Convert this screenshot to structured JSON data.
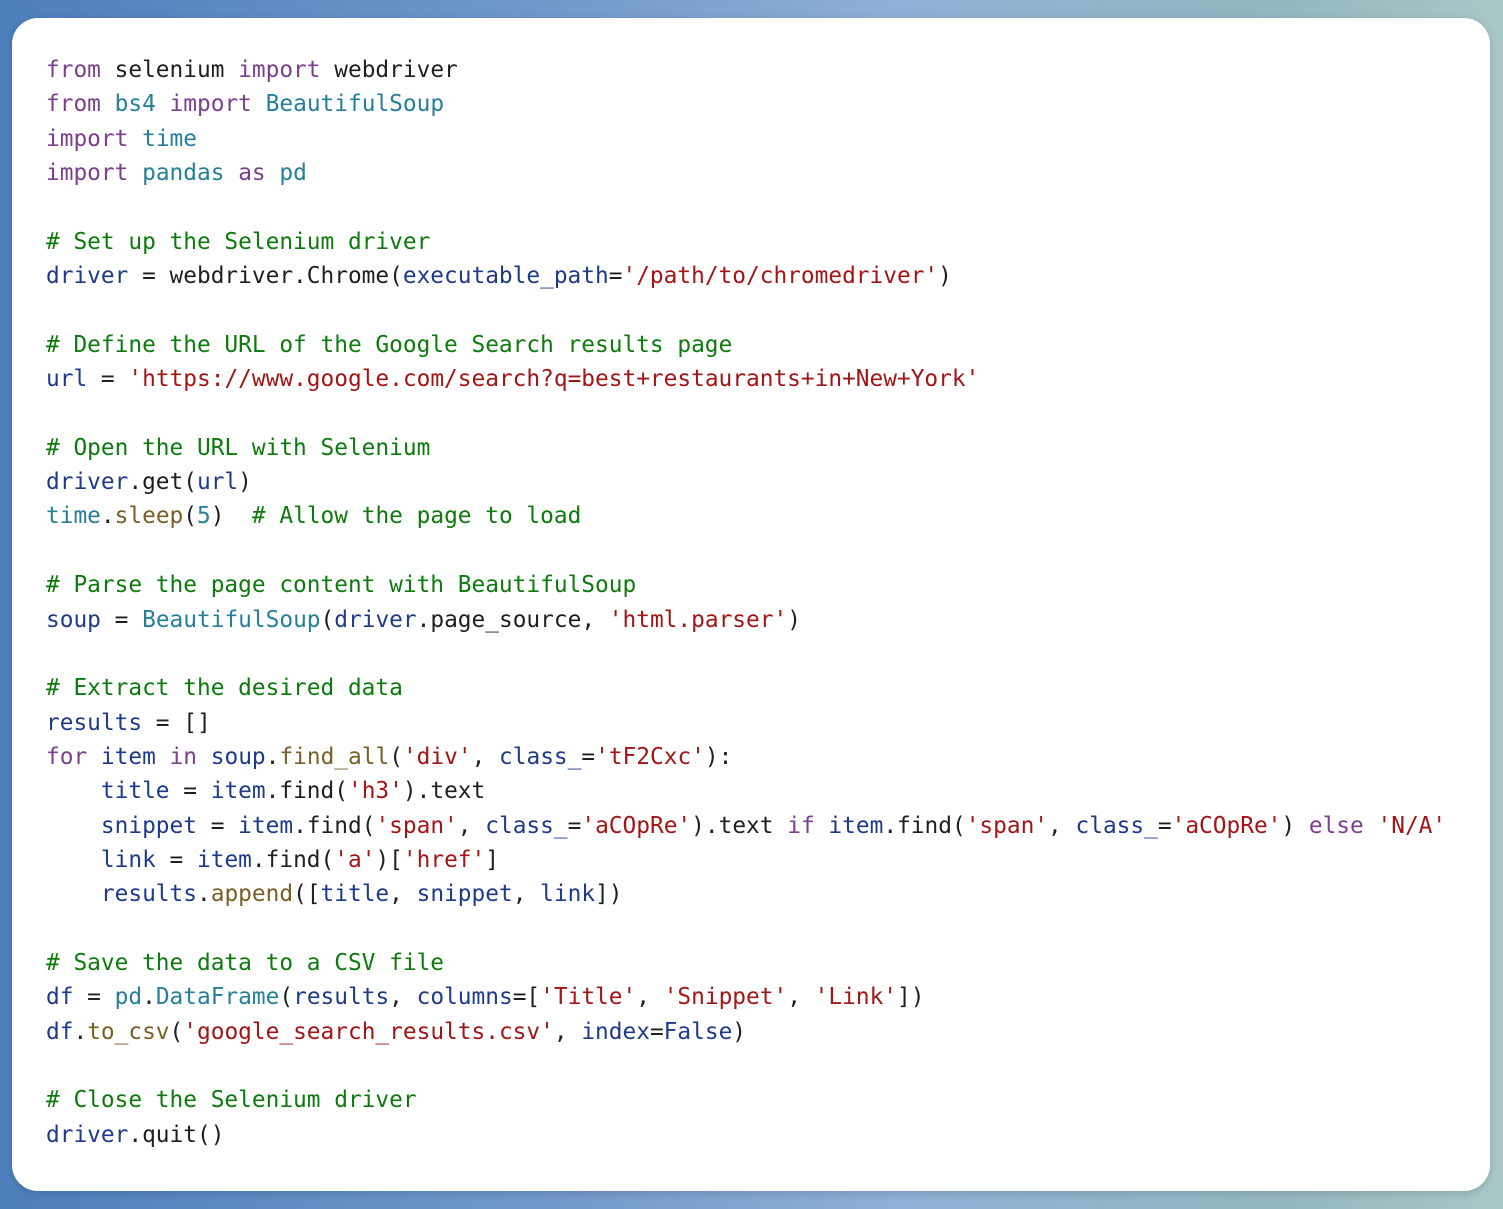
{
  "code_lines": [
    [
      {
        "t": "kw",
        "v": "from"
      },
      {
        "t": "pl",
        "v": " selenium "
      },
      {
        "t": "kw",
        "v": "import"
      },
      {
        "t": "pl",
        "v": " webdriver"
      }
    ],
    [
      {
        "t": "kw",
        "v": "from"
      },
      {
        "t": "pl",
        "v": " "
      },
      {
        "t": "mod",
        "v": "bs4"
      },
      {
        "t": "pl",
        "v": " "
      },
      {
        "t": "kw",
        "v": "import"
      },
      {
        "t": "pl",
        "v": " "
      },
      {
        "t": "mod",
        "v": "BeautifulSoup"
      }
    ],
    [
      {
        "t": "kw",
        "v": "import"
      },
      {
        "t": "pl",
        "v": " "
      },
      {
        "t": "mod",
        "v": "time"
      }
    ],
    [
      {
        "t": "kw",
        "v": "import"
      },
      {
        "t": "pl",
        "v": " "
      },
      {
        "t": "mod",
        "v": "pandas"
      },
      {
        "t": "pl",
        "v": " "
      },
      {
        "t": "kw",
        "v": "as"
      },
      {
        "t": "pl",
        "v": " "
      },
      {
        "t": "mod",
        "v": "pd"
      }
    ],
    [],
    [
      {
        "t": "cm",
        "v": "# Set up the Selenium driver"
      }
    ],
    [
      {
        "t": "prm",
        "v": "driver"
      },
      {
        "t": "pl",
        "v": " = webdriver.Chrome("
      },
      {
        "t": "prm",
        "v": "executable_path"
      },
      {
        "t": "pl",
        "v": "="
      },
      {
        "t": "st",
        "v": "'/path/to/chromedriver'"
      },
      {
        "t": "pl",
        "v": ")"
      }
    ],
    [],
    [
      {
        "t": "cm",
        "v": "# Define the URL of the Google Search results page"
      }
    ],
    [
      {
        "t": "prm",
        "v": "url"
      },
      {
        "t": "pl",
        "v": " = "
      },
      {
        "t": "st",
        "v": "'https://www.google.com/search?q=best+restaurants+in+New+York'"
      }
    ],
    [],
    [
      {
        "t": "cm",
        "v": "# Open the URL with Selenium"
      }
    ],
    [
      {
        "t": "prm",
        "v": "driver"
      },
      {
        "t": "pl",
        "v": ".get("
      },
      {
        "t": "prm",
        "v": "url"
      },
      {
        "t": "pl",
        "v": ")"
      }
    ],
    [
      {
        "t": "mod",
        "v": "time"
      },
      {
        "t": "pl",
        "v": "."
      },
      {
        "t": "fn",
        "v": "sleep"
      },
      {
        "t": "pl",
        "v": "("
      },
      {
        "t": "nm",
        "v": "5"
      },
      {
        "t": "pl",
        "v": ")  "
      },
      {
        "t": "cm",
        "v": "# Allow the page to load"
      }
    ],
    [],
    [
      {
        "t": "cm",
        "v": "# Parse the page content with BeautifulSoup"
      }
    ],
    [
      {
        "t": "prm",
        "v": "soup"
      },
      {
        "t": "pl",
        "v": " = "
      },
      {
        "t": "mod",
        "v": "BeautifulSoup"
      },
      {
        "t": "pl",
        "v": "("
      },
      {
        "t": "prm",
        "v": "driver"
      },
      {
        "t": "pl",
        "v": ".page_source, "
      },
      {
        "t": "st",
        "v": "'html.parser'"
      },
      {
        "t": "pl",
        "v": ")"
      }
    ],
    [],
    [
      {
        "t": "cm",
        "v": "# Extract the desired data"
      }
    ],
    [
      {
        "t": "prm",
        "v": "results"
      },
      {
        "t": "pl",
        "v": " = []"
      }
    ],
    [
      {
        "t": "kw",
        "v": "for"
      },
      {
        "t": "pl",
        "v": " "
      },
      {
        "t": "prm",
        "v": "item"
      },
      {
        "t": "pl",
        "v": " "
      },
      {
        "t": "kw",
        "v": "in"
      },
      {
        "t": "pl",
        "v": " "
      },
      {
        "t": "prm",
        "v": "soup"
      },
      {
        "t": "pl",
        "v": "."
      },
      {
        "t": "fn",
        "v": "find_all"
      },
      {
        "t": "pl",
        "v": "("
      },
      {
        "t": "st",
        "v": "'div'"
      },
      {
        "t": "pl",
        "v": ", "
      },
      {
        "t": "prm",
        "v": "class_"
      },
      {
        "t": "pl",
        "v": "="
      },
      {
        "t": "st",
        "v": "'tF2Cxc'"
      },
      {
        "t": "pl",
        "v": "):"
      }
    ],
    [
      {
        "t": "pl",
        "v": "    "
      },
      {
        "t": "prm",
        "v": "title"
      },
      {
        "t": "pl",
        "v": " = "
      },
      {
        "t": "prm",
        "v": "item"
      },
      {
        "t": "pl",
        "v": ".find("
      },
      {
        "t": "st",
        "v": "'h3'"
      },
      {
        "t": "pl",
        "v": ").text"
      }
    ],
    [
      {
        "t": "pl",
        "v": "    "
      },
      {
        "t": "prm",
        "v": "snippet"
      },
      {
        "t": "pl",
        "v": " = "
      },
      {
        "t": "prm",
        "v": "item"
      },
      {
        "t": "pl",
        "v": ".find("
      },
      {
        "t": "st",
        "v": "'span'"
      },
      {
        "t": "pl",
        "v": ", "
      },
      {
        "t": "prm",
        "v": "class_"
      },
      {
        "t": "pl",
        "v": "="
      },
      {
        "t": "st",
        "v": "'aCOpRe'"
      },
      {
        "t": "pl",
        "v": ").text "
      },
      {
        "t": "kw",
        "v": "if"
      },
      {
        "t": "pl",
        "v": " "
      },
      {
        "t": "prm",
        "v": "item"
      },
      {
        "t": "pl",
        "v": ".find("
      },
      {
        "t": "st",
        "v": "'span'"
      },
      {
        "t": "pl",
        "v": ", "
      },
      {
        "t": "prm",
        "v": "class_"
      },
      {
        "t": "pl",
        "v": "="
      },
      {
        "t": "st",
        "v": "'aCOpRe'"
      },
      {
        "t": "pl",
        "v": ") "
      },
      {
        "t": "kw",
        "v": "else"
      },
      {
        "t": "pl",
        "v": " "
      },
      {
        "t": "st",
        "v": "'N/A'"
      }
    ],
    [
      {
        "t": "pl",
        "v": "    "
      },
      {
        "t": "prm",
        "v": "link"
      },
      {
        "t": "pl",
        "v": " = "
      },
      {
        "t": "prm",
        "v": "item"
      },
      {
        "t": "pl",
        "v": ".find("
      },
      {
        "t": "st",
        "v": "'a'"
      },
      {
        "t": "pl",
        "v": ")["
      },
      {
        "t": "st",
        "v": "'href'"
      },
      {
        "t": "pl",
        "v": "]"
      }
    ],
    [
      {
        "t": "pl",
        "v": "    "
      },
      {
        "t": "prm",
        "v": "results"
      },
      {
        "t": "pl",
        "v": "."
      },
      {
        "t": "fn",
        "v": "append"
      },
      {
        "t": "pl",
        "v": "(["
      },
      {
        "t": "prm",
        "v": "title"
      },
      {
        "t": "pl",
        "v": ", "
      },
      {
        "t": "prm",
        "v": "snippet"
      },
      {
        "t": "pl",
        "v": ", "
      },
      {
        "t": "prm",
        "v": "link"
      },
      {
        "t": "pl",
        "v": "])"
      }
    ],
    [],
    [
      {
        "t": "cm",
        "v": "# Save the data to a CSV file"
      }
    ],
    [
      {
        "t": "prm",
        "v": "df"
      },
      {
        "t": "pl",
        "v": " = "
      },
      {
        "t": "mod",
        "v": "pd"
      },
      {
        "t": "pl",
        "v": "."
      },
      {
        "t": "mod",
        "v": "DataFrame"
      },
      {
        "t": "pl",
        "v": "("
      },
      {
        "t": "prm",
        "v": "results"
      },
      {
        "t": "pl",
        "v": ", "
      },
      {
        "t": "prm",
        "v": "columns"
      },
      {
        "t": "pl",
        "v": "=["
      },
      {
        "t": "st",
        "v": "'Title'"
      },
      {
        "t": "pl",
        "v": ", "
      },
      {
        "t": "st",
        "v": "'Snippet'"
      },
      {
        "t": "pl",
        "v": ", "
      },
      {
        "t": "st",
        "v": "'Link'"
      },
      {
        "t": "pl",
        "v": "])"
      }
    ],
    [
      {
        "t": "prm",
        "v": "df"
      },
      {
        "t": "pl",
        "v": "."
      },
      {
        "t": "fn",
        "v": "to_csv"
      },
      {
        "t": "pl",
        "v": "("
      },
      {
        "t": "st",
        "v": "'google_search_results.csv'"
      },
      {
        "t": "pl",
        "v": ", "
      },
      {
        "t": "prm",
        "v": "index"
      },
      {
        "t": "pl",
        "v": "="
      },
      {
        "t": "prm",
        "v": "False"
      },
      {
        "t": "pl",
        "v": ")"
      }
    ],
    [],
    [
      {
        "t": "cm",
        "v": "# Close the Selenium driver"
      }
    ],
    [
      {
        "t": "prm",
        "v": "driver"
      },
      {
        "t": "pl",
        "v": ".quit()"
      }
    ]
  ],
  "colors": {
    "keyword": "#7b3f8c",
    "module": "#267f99",
    "comment": "#0d7a0d",
    "string": "#a31515",
    "identifier": "#1e3a8a",
    "function": "#795e26",
    "plain": "#1f1f1f",
    "card_bg": "#ffffff"
  }
}
